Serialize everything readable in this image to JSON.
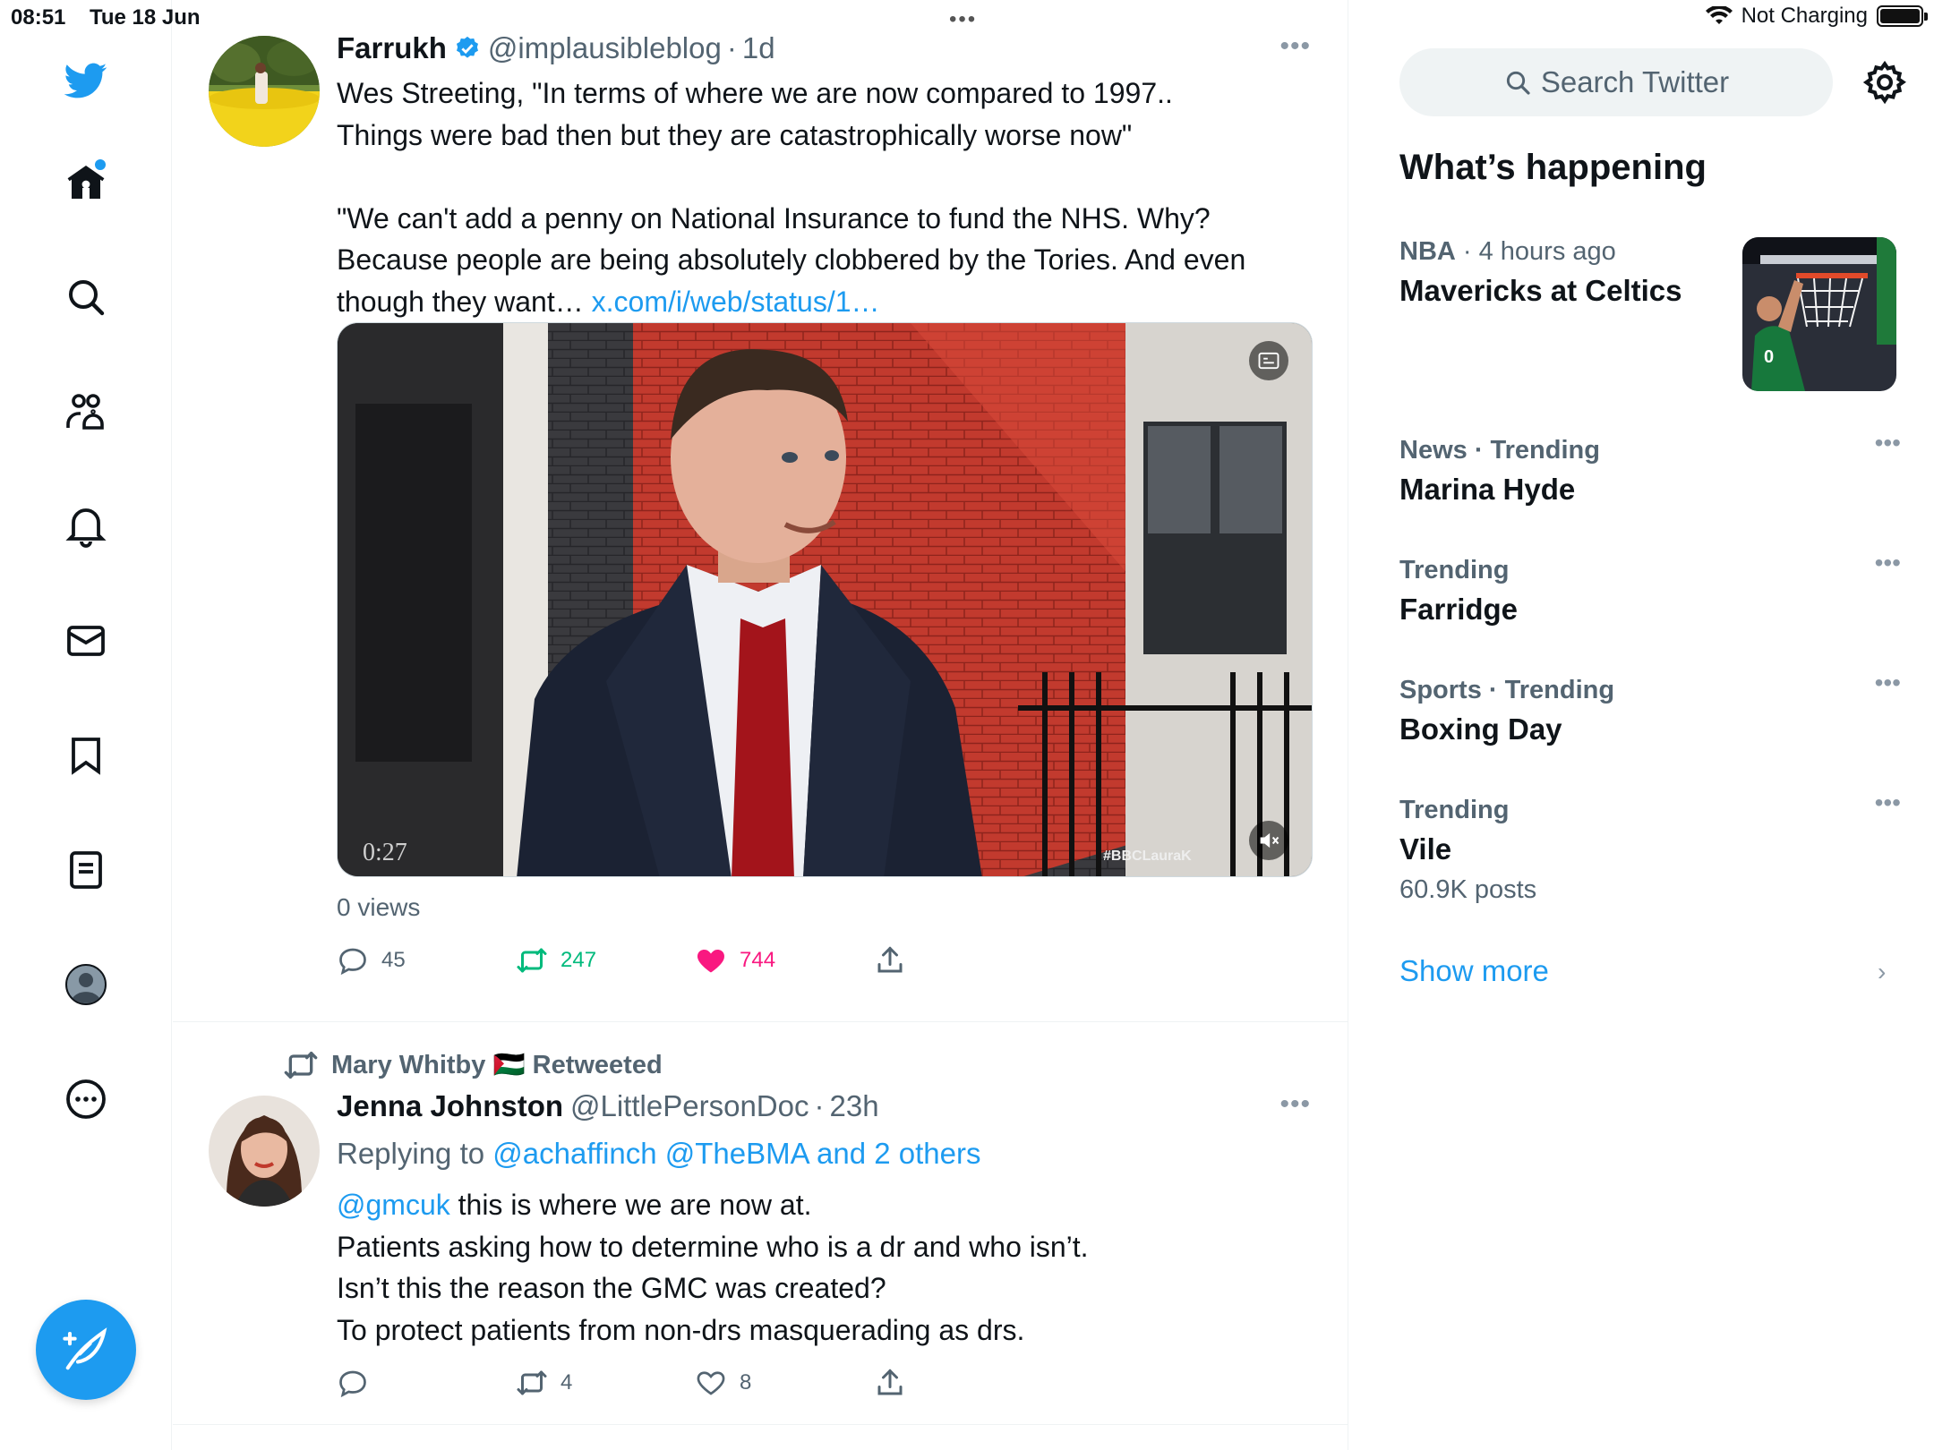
{
  "status_bar": {
    "time": "08:51",
    "date": "Tue 18 Jun",
    "battery_text": "Not Charging"
  },
  "nav": {
    "items": [
      "home",
      "explore",
      "communities",
      "notifications",
      "messages",
      "bookmarks",
      "lists",
      "profile",
      "more"
    ]
  },
  "tweets": [
    {
      "name": "Farrukh",
      "handle": "@implausibleblog",
      "time": "1d",
      "text_lines": [
        "Wes Streeting, \"In terms of where we are now compared to 1997..",
        "Things were bad then but they are catastrophically worse now\"",
        "",
        "\"We can't add a penny on National Insurance to fund the NHS. Why?",
        "Because people are being absolutely clobbered by the Tories. And even",
        "though they want… "
      ],
      "link": "x.com/i/web/status/1…",
      "video_time": "0:27",
      "video_watermark": "#BBCLauraK",
      "views": "0 views",
      "replies": "45",
      "retweets": "247",
      "likes": "744"
    },
    {
      "retweeted_by": "Mary Whitby 🇵🇸 Retweeted",
      "name": "Jenna Johnston",
      "handle": "@LittlePersonDoc",
      "time": "23h",
      "replying_prefix": "Replying to ",
      "replying_to": "@achaffinch @TheBMA and 2 others",
      "mention": "@gmcuk",
      "text_first": " this is where we are now at.",
      "text_lines": [
        "Patients asking how to determine who is a dr and who isn’t.",
        "Isn’t this the reason the GMC was created?",
        "To protect patients from non-drs masquerading as drs."
      ],
      "replies": "",
      "retweets": "4",
      "likes": "8"
    }
  ],
  "right": {
    "search_placeholder": "Search Twitter",
    "heading": "What’s happening",
    "trends": [
      {
        "category": "NBA",
        "meta": " · 4 hours ago",
        "title": "Mavericks at Celtics"
      },
      {
        "category": "News · Trending",
        "meta": "",
        "title": "Marina Hyde"
      },
      {
        "category": "Trending",
        "meta": "",
        "title": "Farridge"
      },
      {
        "category": "Sports · Trending",
        "meta": "",
        "title": "Boxing Day"
      },
      {
        "category": "Trending",
        "meta": "",
        "title": "Vile",
        "posts": "60.9K posts"
      }
    ],
    "show_more": "Show more"
  },
  "colors": {
    "accent": "#1d9bf0",
    "retweet": "#00ba7c",
    "like": "#f91880",
    "muted": "#536471"
  }
}
